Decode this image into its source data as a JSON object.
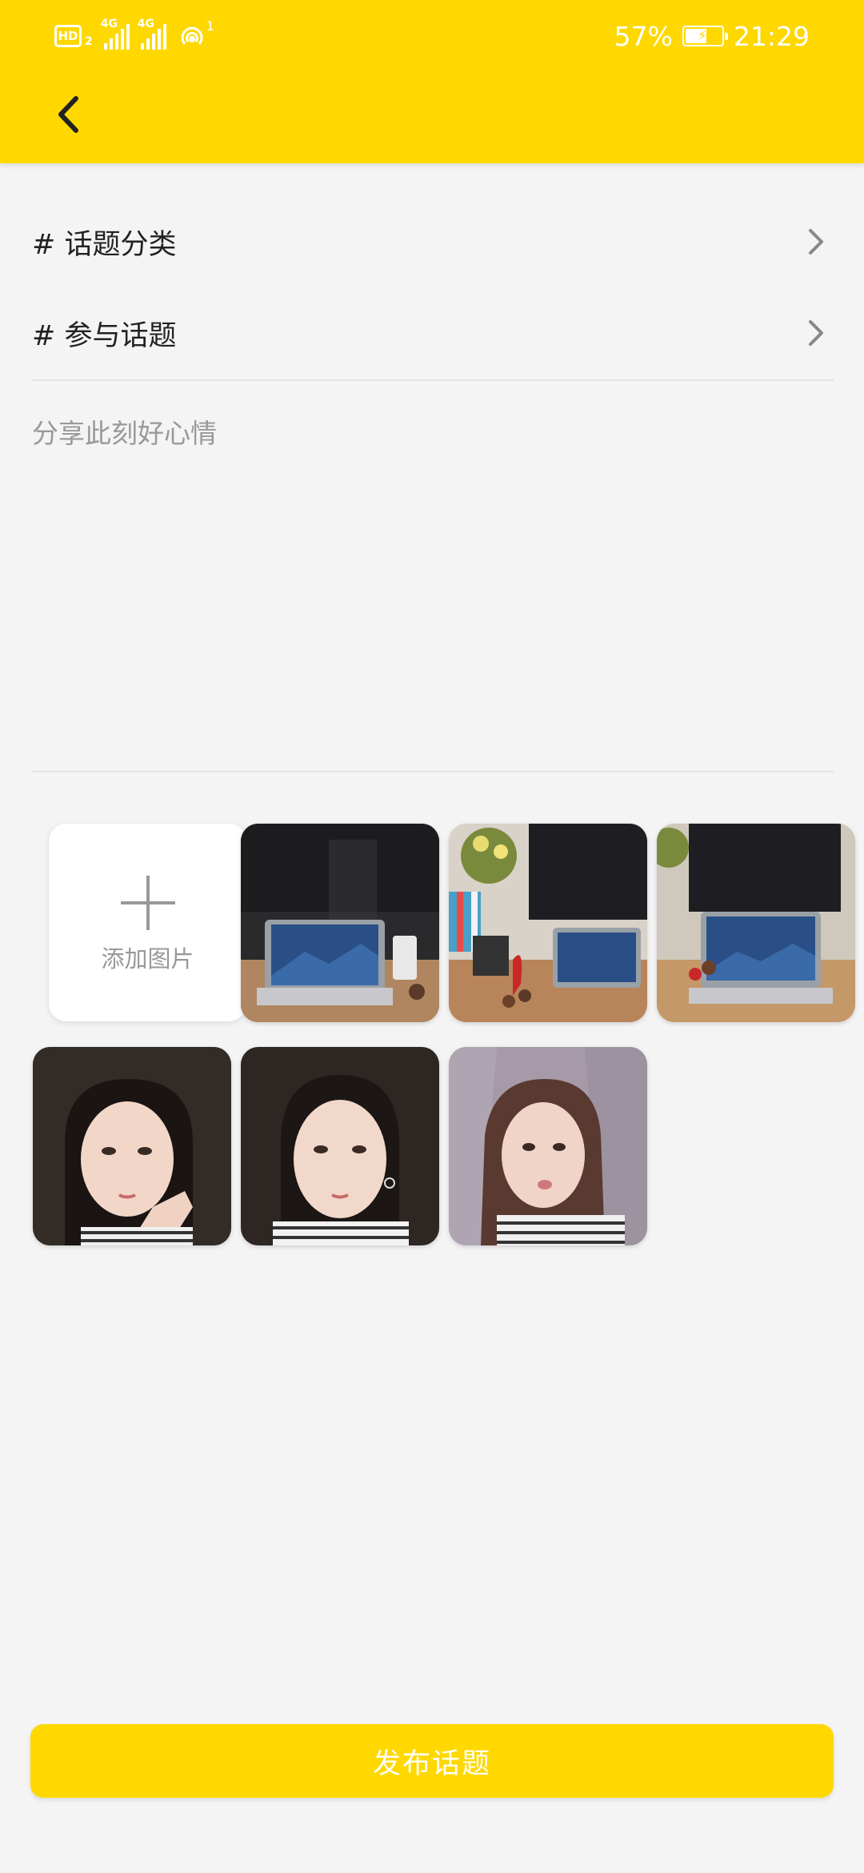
{
  "status_bar": {
    "hd": "HD",
    "sim": "2",
    "net1": "4G",
    "net2": "4G",
    "hotspot_count": "1",
    "battery": "57%",
    "time": "21:29"
  },
  "header": {
    "back_icon": "chevron-left-icon"
  },
  "form": {
    "category_label": "# 话题分类",
    "topic_label": "# 参与话题",
    "content_placeholder": "分享此刻好心情"
  },
  "images": {
    "add_label": "添加图片",
    "photos": [
      {
        "subject": "desk-laptop"
      },
      {
        "subject": "desk-plants-books"
      },
      {
        "subject": "desk-laptop-side"
      },
      {
        "subject": "portrait-hand"
      },
      {
        "subject": "portrait-front"
      },
      {
        "subject": "portrait-pout"
      }
    ]
  },
  "publish_label": "发布话题",
  "colors": {
    "accent": "#ffd800",
    "background": "#f4f4f4"
  }
}
